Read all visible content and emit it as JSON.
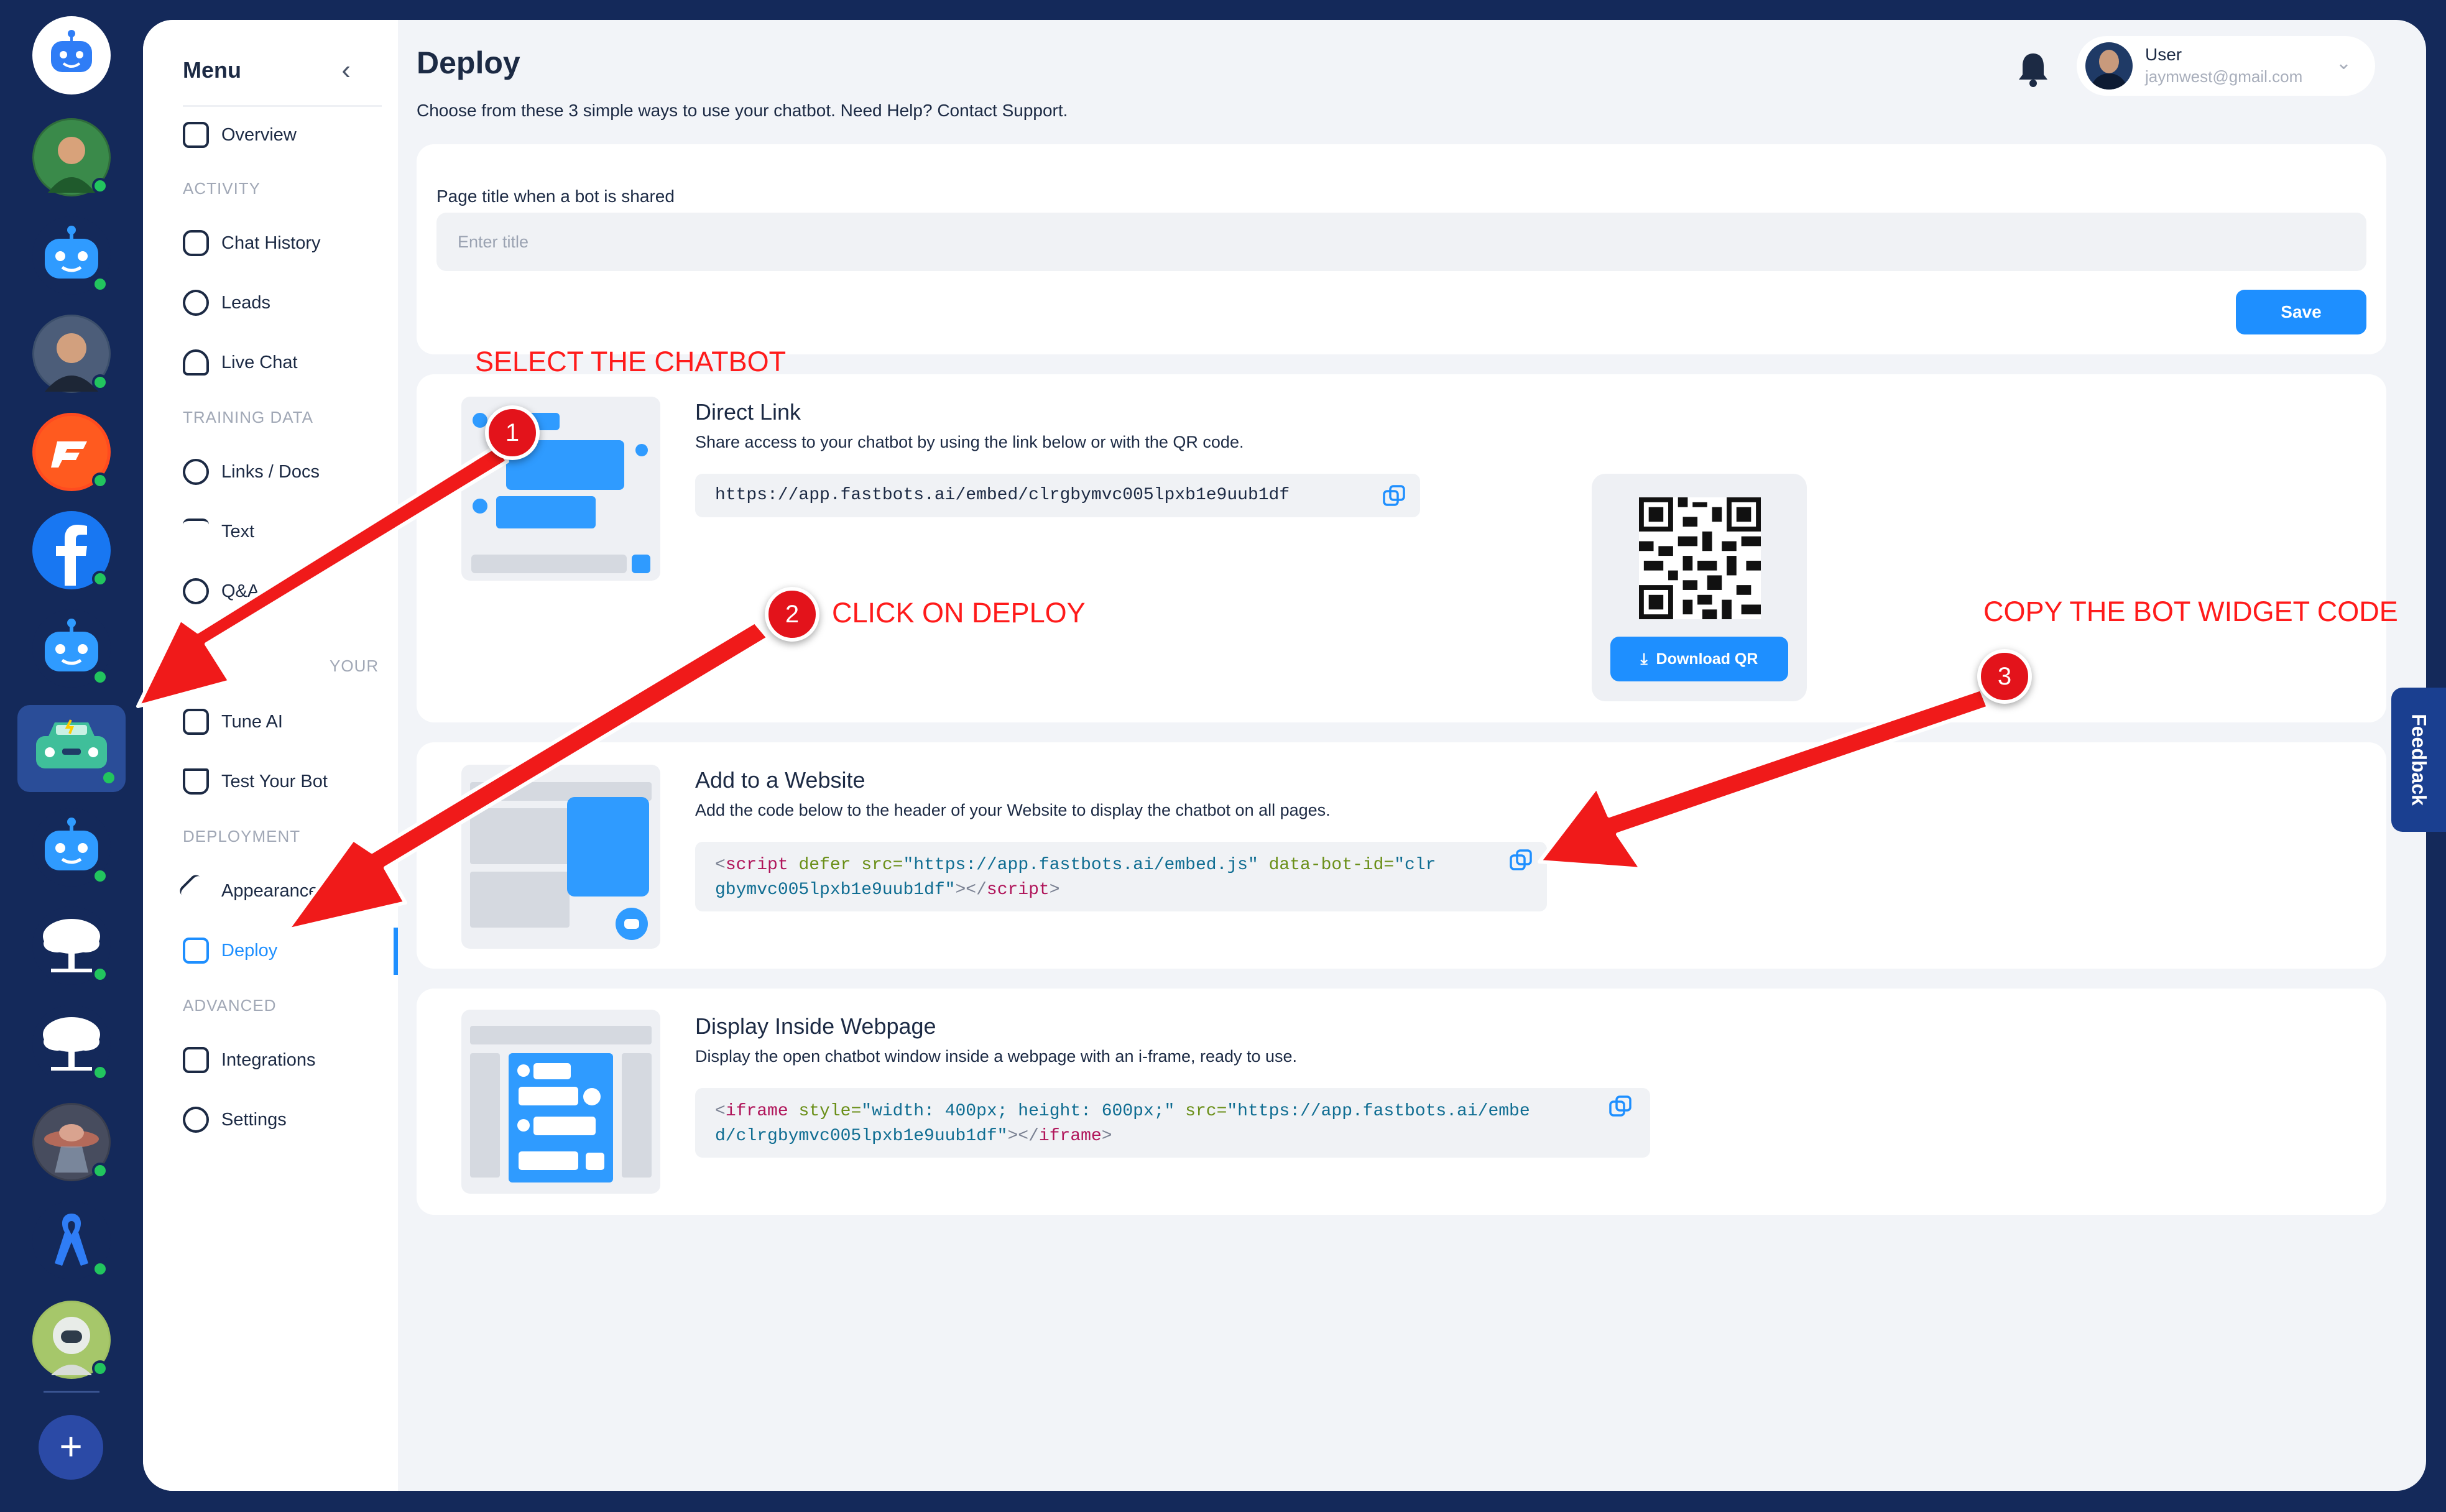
{
  "menu": {
    "title": "Menu",
    "items": {
      "overview": "Overview",
      "chat_history": "Chat History",
      "leads": "Leads",
      "live_chat": "Live Chat",
      "links_docs": "Links / Docs",
      "text": "Text",
      "qa": "Q&A",
      "tune_ai": "Tune AI",
      "test_bot": "Test Your Bot",
      "appearance": "Appearance",
      "deploy": "Deploy",
      "integrations": "Integrations",
      "settings": "Settings"
    },
    "sections": {
      "activity": "ACTIVITY",
      "training": "TRAINING DATA",
      "tune": "YOUR",
      "deployment": "DEPLOYMENT",
      "advanced": "ADVANCED"
    }
  },
  "header": {
    "title": "Deploy",
    "subtitle": "Choose from these 3 simple ways to use your chatbot. Need Help? Contact Support.",
    "user_name": "User",
    "user_email": "jaymwest@gmail.com"
  },
  "share": {
    "label": "Page title when a bot is shared",
    "placeholder": "Enter title",
    "save": "Save"
  },
  "direct_link": {
    "title": "Direct Link",
    "desc": "Share access to your chatbot by using the link below or with the QR code.",
    "url": "https://app.fastbots.ai/embed/clrgbymvc005lpxb1e9uub1df",
    "download_qr": "Download QR"
  },
  "website": {
    "title": "Add to a Website",
    "desc": "Add the code below to the header of your Website to display the chatbot on all pages.",
    "code": {
      "open": "<",
      "tag": "script",
      "attr1": " defer src=",
      "val1": "\"https://app.fastbots.ai/embed.js\"",
      "attr2": " data-bot-id=",
      "val2a": "\"clr",
      "val2b": "gbymvc005lpxb1e9uub1df\"",
      "mid": "></",
      "close": ">"
    }
  },
  "iframe": {
    "title": "Display Inside Webpage",
    "desc": "Display the open chatbot window inside a webpage with an i-frame, ready to use.",
    "code": {
      "open": "<",
      "tag": "iframe",
      "attr1": " style=",
      "val1": "\"width: 400px; height: 600px;\"",
      "attr2": " src=",
      "val2a": "\"https://app.fastbots.ai/embe",
      "val2b": "d/clrgbymvc005lpxb1e9uub1df\"",
      "mid": "></",
      "close": ">"
    }
  },
  "feedback": "Feedback",
  "annotations": {
    "step1": "SELECT THE CHATBOT",
    "step2": "CLICK ON DEPLOY",
    "step3": "COPY THE BOT WIDGET CODE",
    "n1": "1",
    "n2": "2",
    "n3": "3"
  },
  "colors": {
    "accent": "#1e8fff",
    "rail": "#14295a",
    "annotation": "#ff1b1b",
    "online": "#22c55e"
  }
}
